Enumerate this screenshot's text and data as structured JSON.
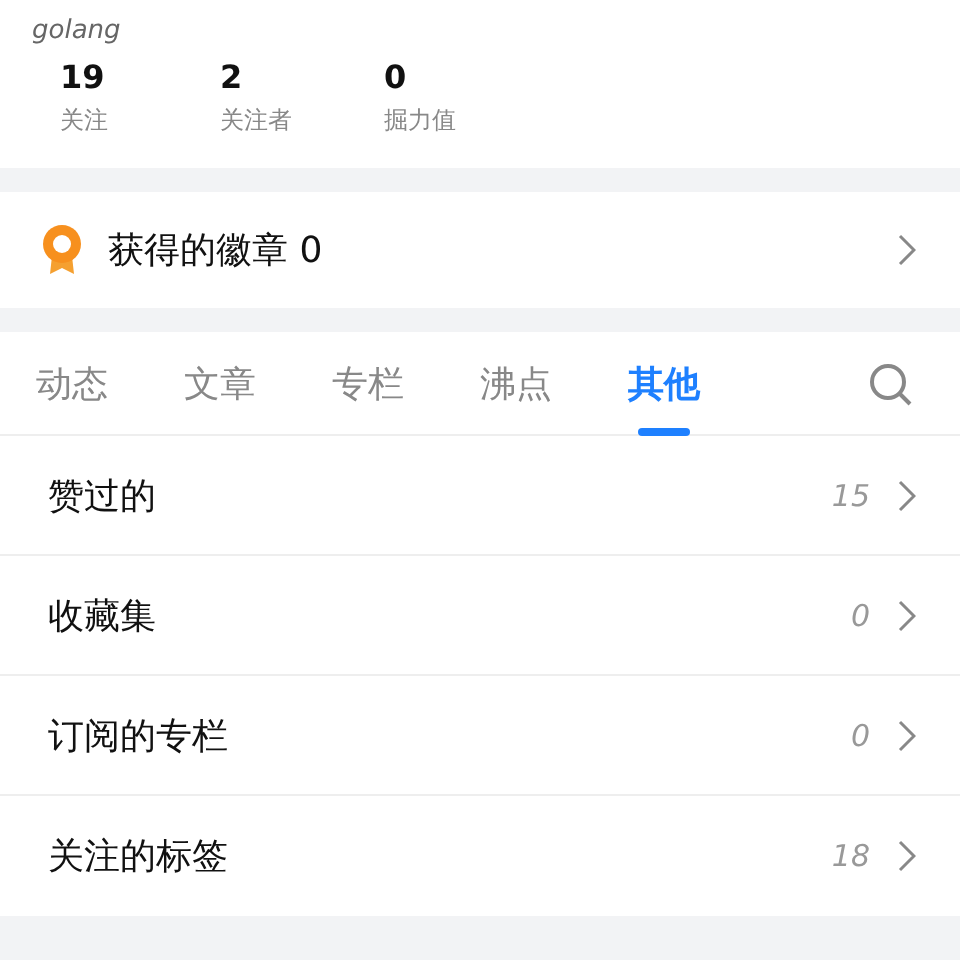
{
  "profile": {
    "name": "golang",
    "stats": [
      {
        "value": "19",
        "label": "关注"
      },
      {
        "value": "2",
        "label": "关注者"
      },
      {
        "value": "0",
        "label": "掘力值"
      }
    ]
  },
  "badges": {
    "label": "获得的徽章 0"
  },
  "tabs": [
    {
      "label": "动态",
      "selected": false
    },
    {
      "label": "文章",
      "selected": false
    },
    {
      "label": "专栏",
      "selected": false
    },
    {
      "label": "沸点",
      "selected": false
    },
    {
      "label": "其他",
      "selected": true
    }
  ],
  "items": [
    {
      "label": "赞过的",
      "count": "15"
    },
    {
      "label": "收藏集",
      "count": "0"
    },
    {
      "label": "订阅的专栏",
      "count": "0"
    },
    {
      "label": "关注的标签",
      "count": "18"
    }
  ]
}
